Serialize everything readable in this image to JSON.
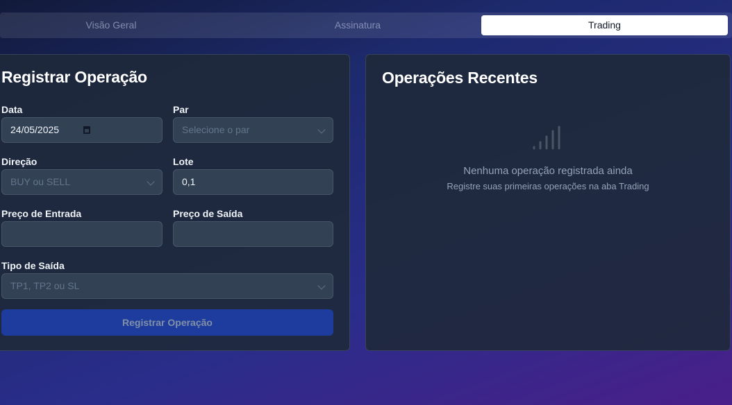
{
  "tabs": [
    {
      "label": "Visão Geral",
      "active": false
    },
    {
      "label": "Assinatura",
      "active": false
    },
    {
      "label": "Trading",
      "active": true
    }
  ],
  "form": {
    "title": "Registrar Operação",
    "date_label": "Data",
    "date_value": "24/05/2025",
    "pair_label": "Par",
    "pair_placeholder": "Selecione o par",
    "direction_label": "Direção",
    "direction_placeholder": "BUY ou SELL",
    "lot_label": "Lote",
    "lot_value": "0,1",
    "entry_label": "Preço de Entrada",
    "entry_value": "",
    "exit_label": "Preço de Saída",
    "exit_value": "",
    "exit_type_label": "Tipo de Saída",
    "exit_type_placeholder": "TP1, TP2 ou SL",
    "submit_label": "Registrar Operação"
  },
  "recent": {
    "title": "Operações Recentes",
    "empty_title": "Nenhuma operação registrada ainda",
    "empty_subtitle": "Registre suas primeiras operações na aba Trading",
    "empty_icon": "signal-bars-icon"
  },
  "colors": {
    "accent_button": "#1e40af",
    "card_bg": "#1e293b",
    "input_bg": "#334155"
  }
}
